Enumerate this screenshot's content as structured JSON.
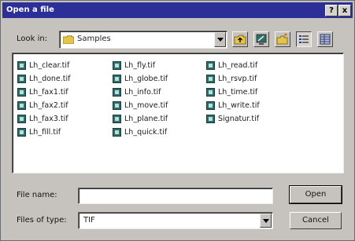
{
  "title": "Open a file",
  "title_buttons": {
    "help": "?",
    "close": "x"
  },
  "look_in": {
    "label": "Look in:",
    "value": "Samples"
  },
  "toolbar": {
    "icons": [
      "up-folder-icon",
      "desktop-icon",
      "new-folder-icon",
      "list-view-icon",
      "details-view-icon"
    ]
  },
  "files": {
    "col1": [
      "Lh_clear.tif",
      "Lh_done.tif",
      "Lh_fax1.tif",
      "Lh_fax2.tif",
      "Lh_fax3.tif",
      "Lh_fill.tif"
    ],
    "col2": [
      "Lh_fly.tif",
      "Lh_globe.tif",
      "Lh_info.tif",
      "Lh_move.tif",
      "Lh_plane.tif",
      "Lh_quick.tif"
    ],
    "col3": [
      "Lh_read.tif",
      "Lh_rsvp.tif",
      "Lh_time.tif",
      "Lh_write.tif",
      "Signatur.tif"
    ]
  },
  "file_name": {
    "label": "File name:",
    "value": ""
  },
  "file_type": {
    "label": "Files of type:",
    "value": "TIF"
  },
  "buttons": {
    "open": "Open",
    "cancel": "Cancel"
  },
  "colors": {
    "titlebar": "#2c2f97",
    "dialog": "#c6c2bd",
    "file_icon": "#2e6d69"
  }
}
